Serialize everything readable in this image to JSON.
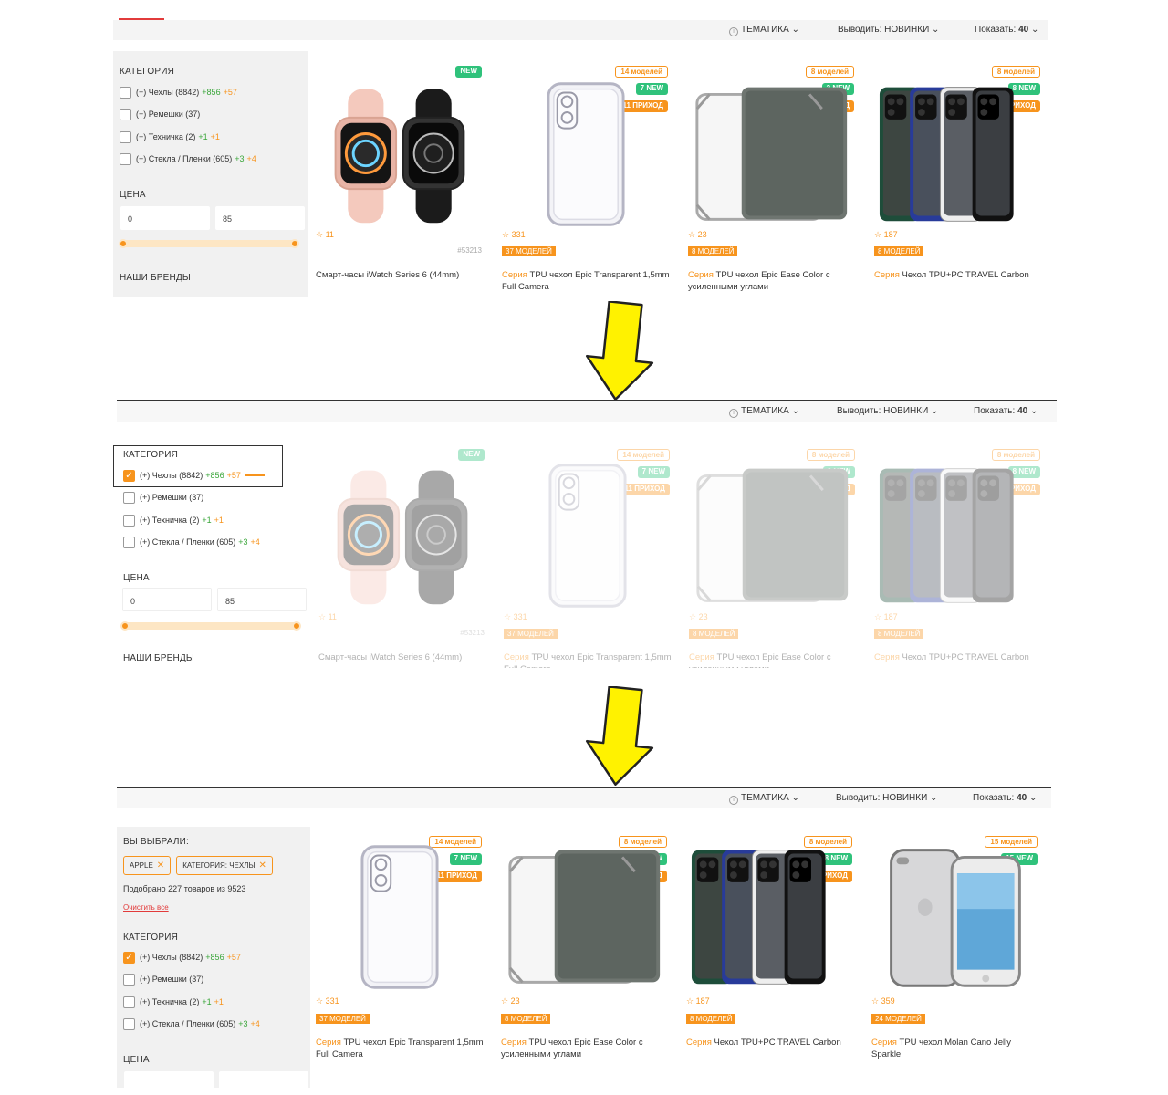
{
  "topbar": {
    "theme": "ТЕМАТИКА",
    "output_label": "Выводить:",
    "output_value": "НОВИНКИ",
    "show_label": "Показать:",
    "show_value": "40"
  },
  "sidebar": {
    "category_title": "КАТЕГОРИЯ",
    "categories": [
      {
        "label": "(+) Чехлы (8842)",
        "g": "+856",
        "o": "+57"
      },
      {
        "label": "(+) Ремешки (37)",
        "g": "",
        "o": ""
      },
      {
        "label": "(+) Техничка (2)",
        "g": "+1",
        "o": "+1"
      },
      {
        "label": "(+) Стекла / Пленки (605)",
        "g": "+3",
        "o": "+4"
      }
    ],
    "price_title": "ЦЕНА",
    "price_min": "0",
    "price_max": "85",
    "brands_title": "НАШИ БРЕНДЫ",
    "chosen_title": "ВЫ ВЫБРАЛИ:",
    "chips": [
      "APPLE",
      "КАТЕГОРИЯ: ЧЕХЛЫ"
    ],
    "found": "Подобрано 227 товаров из 9523",
    "clear": "Очистить все"
  },
  "products": [
    {
      "badges": [
        {
          "t": "NEW",
          "k": "bg"
        }
      ],
      "rating": "11",
      "models": "",
      "sku": "#53213",
      "series": "",
      "title": "Смарт-часы iWatch Series 6 (44mm)",
      "pic": "watch"
    },
    {
      "badges": [
        {
          "t": "14 моделей",
          "k": "bo"
        },
        {
          "t": "7 NEW",
          "k": "bg"
        },
        {
          "t": "11 ПРИХОД",
          "k": "bor"
        }
      ],
      "rating": "331",
      "models": "37 МОДЕЛЕЙ",
      "sku": "",
      "series": "Серия",
      "title": "TPU чехол Epic Transparent 1,5mm Full Camera",
      "pic": "clear"
    },
    {
      "badges": [
        {
          "t": "8 моделей",
          "k": "bo"
        },
        {
          "t": "3 NEW",
          "k": "bg"
        },
        {
          "t": "4 ПРИХОД",
          "k": "bor"
        }
      ],
      "rating": "23",
      "models": "8 МОДЕЛЕЙ",
      "sku": "",
      "series": "Серия",
      "title": "TPU чехол Epic Ease Color с усиленными углами",
      "pic": "tablet"
    },
    {
      "badges": [
        {
          "t": "8 моделей",
          "k": "bo"
        },
        {
          "t": "8 NEW",
          "k": "bg"
        },
        {
          "t": "8 ПРИХОД",
          "k": "bor"
        }
      ],
      "rating": "187",
      "models": "8 МОДЕЛЕЙ",
      "sku": "",
      "series": "Серия",
      "title": "Чехол TPU+PC TRAVEL Carbon",
      "pic": "cases"
    },
    {
      "badges": [
        {
          "t": "15 моделей",
          "k": "bo"
        },
        {
          "t": "15 NEW",
          "k": "bg"
        }
      ],
      "rating": "359",
      "models": "24 МОДЕЛЕЙ",
      "sku": "",
      "series": "Серия",
      "title": "TPU чехол Molan Cano Jelly Sparkle",
      "pic": "iphone"
    }
  ],
  "colors": {
    "accent": "#f7941d",
    "green": "#2fc27b",
    "red": "#e23b3b",
    "arrow": "#fff200"
  }
}
